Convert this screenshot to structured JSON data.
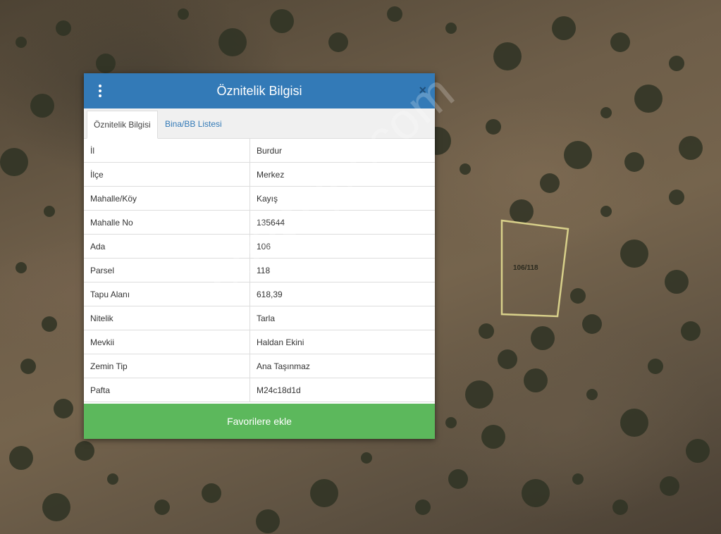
{
  "dialog": {
    "title": "Öznitelik Bilgisi",
    "close_label": "×",
    "tabs": [
      {
        "label": "Öznitelik Bilgisi",
        "active": true
      },
      {
        "label": "Bina/BB Listesi",
        "active": false
      }
    ],
    "rows": [
      {
        "key": "İl",
        "value": "Burdur"
      },
      {
        "key": "İlçe",
        "value": "Merkez"
      },
      {
        "key": "Mahalle/Köy",
        "value": "Kayış"
      },
      {
        "key": "Mahalle No",
        "value": "135644"
      },
      {
        "key": "Ada",
        "value": "106"
      },
      {
        "key": "Parsel",
        "value": "118"
      },
      {
        "key": "Tapu Alanı",
        "value": "618,39"
      },
      {
        "key": "Nitelik",
        "value": "Tarla"
      },
      {
        "key": "Mevkii",
        "value": "Haldan Ekini"
      },
      {
        "key": "Zemin Tip",
        "value": "Ana Taşınmaz"
      },
      {
        "key": "Pafta",
        "value": "M24c18d1d"
      }
    ],
    "favorite_button": "Favorilere ekle"
  },
  "map": {
    "parcel_label": "106/118",
    "parcel_outline_color": "#d8d08a"
  },
  "watermark": "emlakjet.com",
  "colors": {
    "header": "#337ab7",
    "favorite": "#5cb85c"
  }
}
